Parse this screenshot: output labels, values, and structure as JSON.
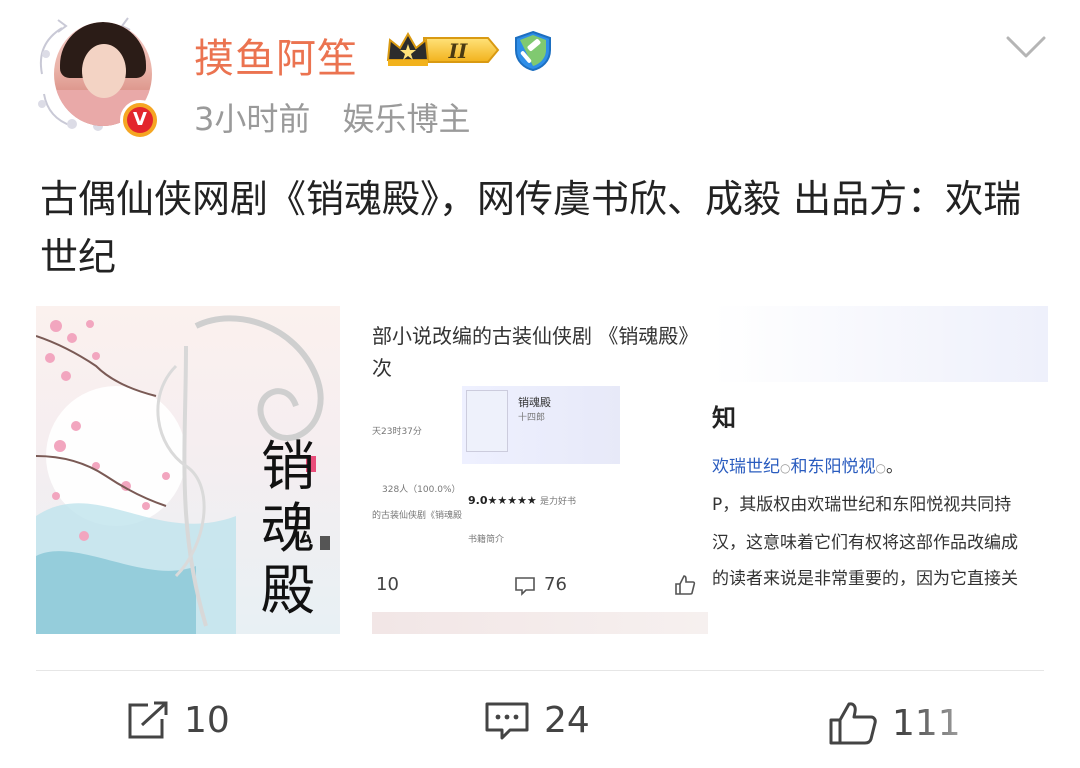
{
  "user": {
    "name": "摸鱼阿笙",
    "level": "II",
    "verified_badge": "V",
    "time": "3小时前",
    "tag": "娱乐博主"
  },
  "post": {
    "text": "古偶仙侠网剧《销魂殿》，网传虞书欣、成毅 出品方：欢瑞世纪"
  },
  "images": {
    "poster": {
      "title": "销魂殿"
    },
    "screenshot2": {
      "heading": "部小说改编的古装仙侠剧 《销魂殿》",
      "heading2": "次",
      "book_title": "销魂殿",
      "book_author": "十四郎",
      "time_text": "天23时37分",
      "count_text": "328人（100.0%）",
      "score": "9.0★★★★★",
      "desc": "的古装仙侠剧《销魂殿",
      "section": "书籍简介",
      "good_book": "是力好书",
      "stat_left": "10",
      "stat_comments": "76"
    },
    "screenshot3": {
      "big_char": "知",
      "line1_a": "欢瑞世纪",
      "line1_b": "和东阳悦视",
      "line1_c": "。",
      "line2": "P，其版权由欢瑞世纪和东阳悦视共同持",
      "line3": "汉，这意味着它们有权将这部作品改编成",
      "line4": "的读者来说是非常重要的，因为它直接关"
    }
  },
  "actions": {
    "forward": "10",
    "comment": "24",
    "like": "111"
  },
  "colors": {
    "username": "#eb7350",
    "meta": "#9a9a9a",
    "link": "#2a5cbf"
  }
}
